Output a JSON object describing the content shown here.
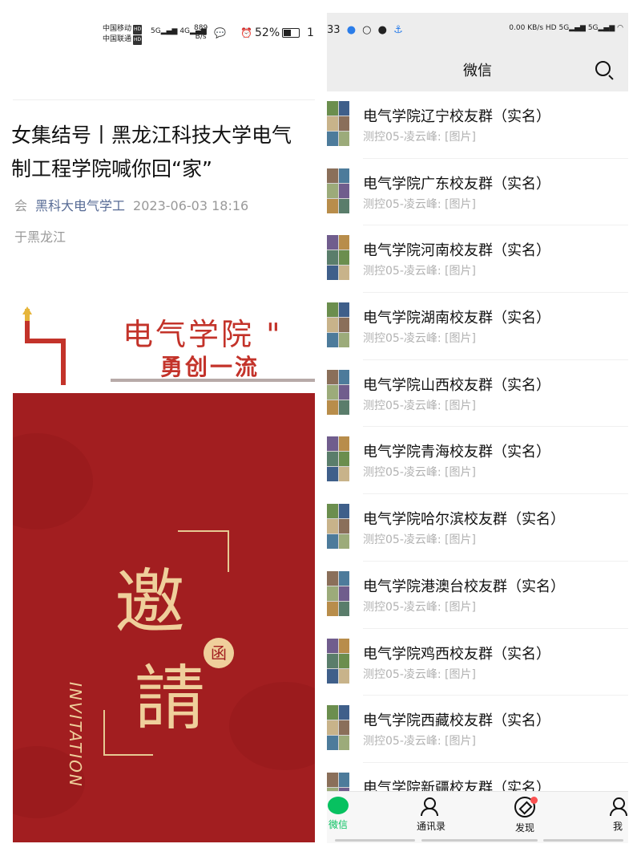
{
  "left": {
    "status": {
      "carrier1": "中国移动",
      "carrier2": "中国联通",
      "hd": "HD",
      "sig1": "5G",
      "sig2": "4G",
      "speed_value": "889",
      "speed_unit": "B/s",
      "battery": "52%",
      "time": "1"
    },
    "article": {
      "title_line1": "女集结号丨黑龙江科技大学电气",
      "title_line2": "制工程学院喊你回“家”",
      "meta_prefix": "会",
      "author": "黑科大电气学工",
      "date": "2023-06-03 18:16",
      "location": "于黑龙江"
    },
    "banner": {
      "line1": "电气学院 \"",
      "line2": "勇创一流"
    },
    "poster": {
      "char1": "邀",
      "char2": "請",
      "seal": "函",
      "invitation": "INVITATION"
    }
  },
  "right": {
    "status": {
      "time": "33",
      "net_speed": "0.00",
      "net_unit": "KB/s",
      "hd": "HD",
      "sig": "5G"
    },
    "header": {
      "title": "微信"
    },
    "chats": [
      {
        "name": "电气学院辽宁校友群（实名）",
        "msg": "测控05-凌云峰: [图片]"
      },
      {
        "name": "电气学院广东校友群（实名）",
        "msg": "测控05-凌云峰: [图片]"
      },
      {
        "name": "电气学院河南校友群（实名）",
        "msg": "测控05-凌云峰: [图片]"
      },
      {
        "name": "电气学院湖南校友群（实名）",
        "msg": "测控05-凌云峰: [图片]"
      },
      {
        "name": "电气学院山西校友群（实名）",
        "msg": "测控05-凌云峰: [图片]"
      },
      {
        "name": "电气学院青海校友群（实名）",
        "msg": "测控05-凌云峰: [图片]"
      },
      {
        "name": "电气学院哈尔滨校友群（实名）",
        "msg": "测控05-凌云峰: [图片]"
      },
      {
        "name": "电气学院港澳台校友群（实名）",
        "msg": "测控05-凌云峰: [图片]"
      },
      {
        "name": "电气学院鸡西校友群（实名）",
        "msg": "测控05-凌云峰: [图片]"
      },
      {
        "name": "电气学院西藏校友群（实名）",
        "msg": "测控05-凌云峰: [图片]"
      },
      {
        "name": "电气学院新疆校友群（实名）",
        "msg": ""
      }
    ],
    "tabs": {
      "chats": "微信",
      "contacts": "通讯录",
      "discover": "发现",
      "me": "我"
    }
  },
  "colors": {
    "wechat_green": "#07c160",
    "poster_red": "#a21e20",
    "gold": "#efcf9b",
    "link_blue": "#576b95"
  }
}
